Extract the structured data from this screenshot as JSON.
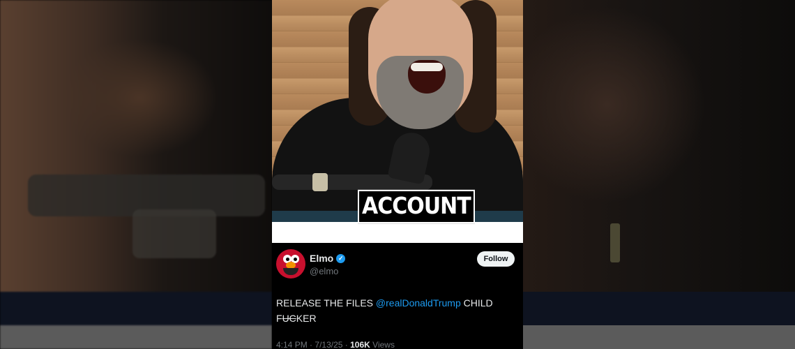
{
  "caption": "ACCOUNT",
  "tweet": {
    "name": "Elmo",
    "handle": "@elmo",
    "verified_mark": "✓",
    "follow_label": "Follow",
    "text_part1": "RELEASE THE FILES ",
    "mention": "@realDonaldTrump",
    "text_part2": " CHILD",
    "text_line2_censored": "F",
    "text_line2_redacted": "UC",
    "text_line2_rest": "KER",
    "time": "4:14 PM",
    "date": "7/13/25",
    "views_count": "106K",
    "views_label": "Views",
    "separator": "·"
  },
  "colors": {
    "link": "#1d9bf0",
    "verified": "#1d9bf0",
    "muted": "#71767b"
  }
}
